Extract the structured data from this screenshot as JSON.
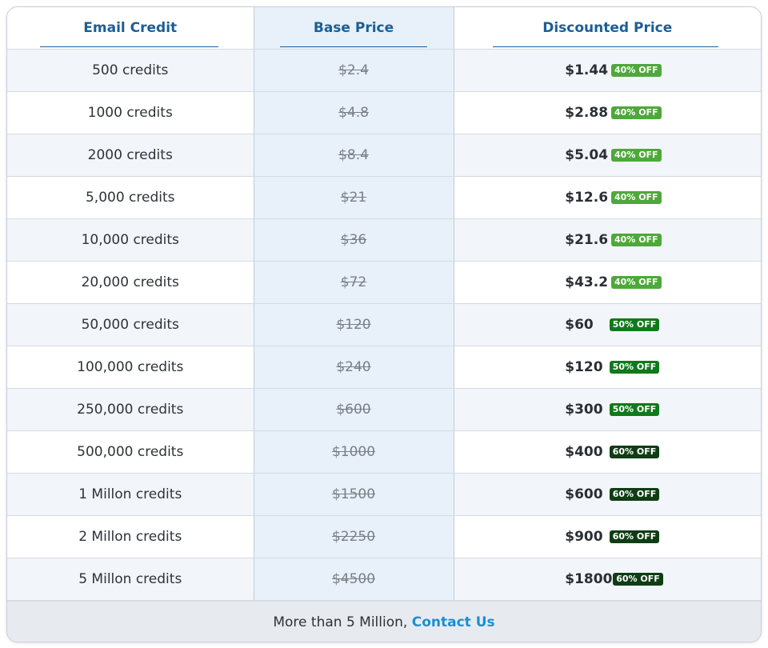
{
  "headers": {
    "email_credit": "Email Credit",
    "base_price": "Base Price",
    "discounted_price": "Discounted Price"
  },
  "rows": [
    {
      "credits": "500 credits",
      "base": "$2.4",
      "price": "$1.44",
      "badge": "40% OFF",
      "badge_color": "#4ea83a"
    },
    {
      "credits": "1000 credits",
      "base": "$4.8",
      "price": "$2.88",
      "badge": "40% OFF",
      "badge_color": "#4ea83a"
    },
    {
      "credits": "2000 credits",
      "base": "$8.4",
      "price": "$5.04",
      "badge": "40% OFF",
      "badge_color": "#4ea83a"
    },
    {
      "credits": "5,000 credits",
      "base": "$21",
      "price": "$12.6",
      "badge": "40% OFF",
      "badge_color": "#4ea83a"
    },
    {
      "credits": "10,000 credits",
      "base": "$36",
      "price": "$21.6",
      "badge": "40% OFF",
      "badge_color": "#4ea83a"
    },
    {
      "credits": "20,000 credits",
      "base": "$72",
      "price": "$43.2",
      "badge": "40% OFF",
      "badge_color": "#4ea83a"
    },
    {
      "credits": "50,000 credits",
      "base": "$120",
      "price": "$60",
      "badge": "50% OFF",
      "badge_color": "#0f7a1a"
    },
    {
      "credits": "100,000 credits",
      "base": "$240",
      "price": "$120",
      "badge": "50% OFF",
      "badge_color": "#0f7a1a"
    },
    {
      "credits": "250,000 credits",
      "base": "$600",
      "price": "$300",
      "badge": "50% OFF",
      "badge_color": "#0f7a1a"
    },
    {
      "credits": "500,000 credits",
      "base": "$1000",
      "price": "$400",
      "badge": "60% OFF",
      "badge_color": "#0f3d14"
    },
    {
      "credits": "1 Millon credits",
      "base": "$1500",
      "price": "$600",
      "badge": "60% OFF",
      "badge_color": "#0f3d14"
    },
    {
      "credits": "2 Millon credits",
      "base": "$2250",
      "price": "$900",
      "badge": "60% OFF",
      "badge_color": "#0f3d14"
    },
    {
      "credits": "5 Millon credits",
      "base": "$4500",
      "price": "$1800",
      "badge": "60% OFF",
      "badge_color": "#0f3d14"
    }
  ],
  "footer": {
    "text": "More than 5 Million,",
    "link": "Contact Us"
  },
  "colors": {
    "header_text": "#1b5e95",
    "link": "#1a8fd6",
    "base_column_bg": "#e8f0f9"
  }
}
